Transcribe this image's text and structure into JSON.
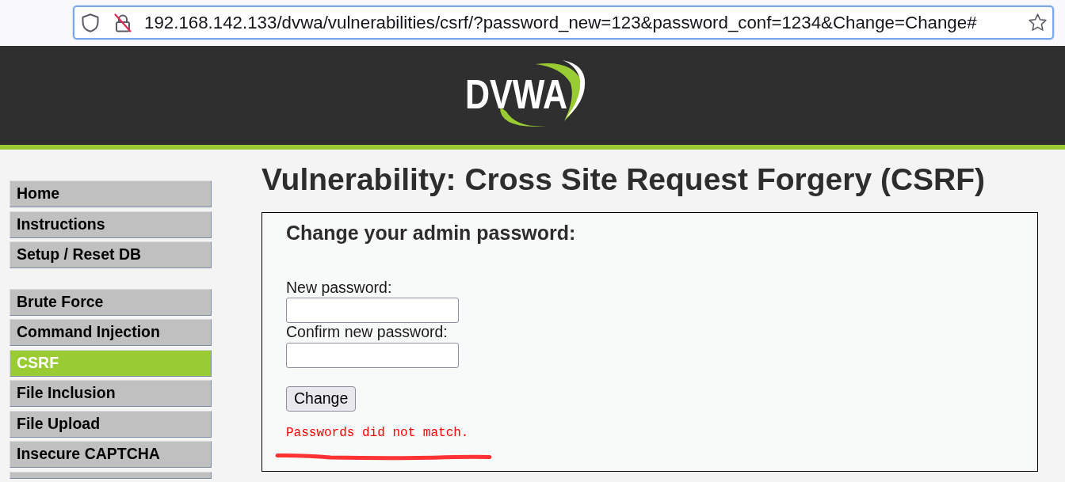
{
  "browser": {
    "address": "192.168.142.133/dvwa/vulnerabilities/csrf/?password_new=123&password_conf=1234&Change=Change#"
  },
  "header": {
    "logo": "DVWA"
  },
  "sidebar": {
    "groups": [
      {
        "items": [
          {
            "label": "Home",
            "selected": false
          },
          {
            "label": "Instructions",
            "selected": false
          },
          {
            "label": "Setup / Reset DB",
            "selected": false
          }
        ]
      },
      {
        "items": [
          {
            "label": "Brute Force",
            "selected": false
          },
          {
            "label": "Command Injection",
            "selected": false
          },
          {
            "label": "CSRF",
            "selected": true
          },
          {
            "label": "File Inclusion",
            "selected": false
          },
          {
            "label": "File Upload",
            "selected": false
          },
          {
            "label": "Insecure CAPTCHA",
            "selected": false
          }
        ]
      }
    ]
  },
  "main": {
    "title": "Vulnerability: Cross Site Request Forgery (CSRF)",
    "form": {
      "heading": "Change your admin password:",
      "fields": [
        {
          "label": "New password:"
        },
        {
          "label": "Confirm new password:"
        }
      ],
      "button": "Change",
      "message": "Passwords did not match."
    }
  }
}
